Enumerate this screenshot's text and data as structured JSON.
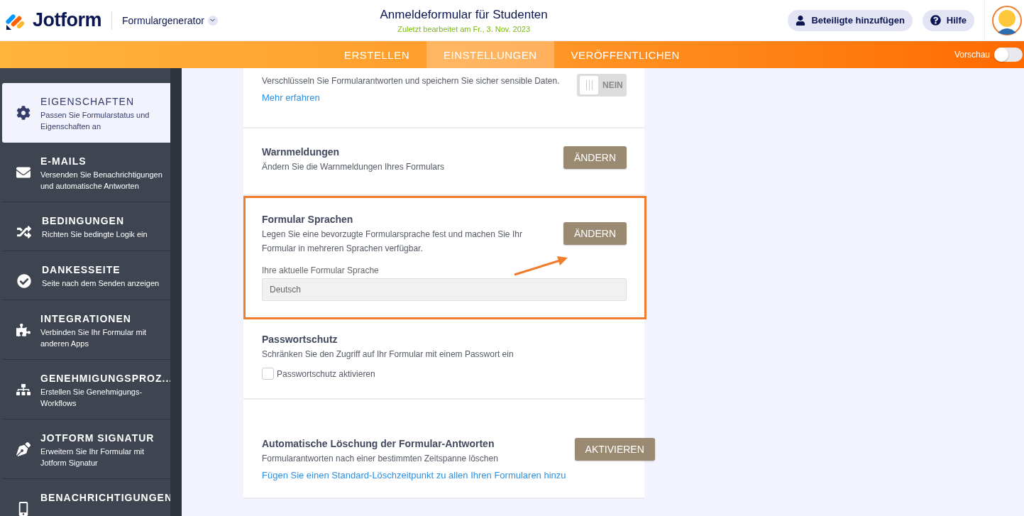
{
  "header": {
    "logo": "Jotform",
    "builder_menu": "Formulargenerator",
    "form_title": "Anmeldeformular für Studenten",
    "last_edited": "Zuletzt bearbeitet am Fr., 3. Nov. 2023",
    "buttons": [
      {
        "kind": "person",
        "label": "Beteiligte hinzufügen"
      },
      {
        "kind": "help",
        "label": "Hilfe"
      }
    ]
  },
  "tabs": [
    {
      "label": "ERSTELLEN",
      "selected": false
    },
    {
      "label": "EINSTELLUNGEN",
      "selected": true
    },
    {
      "label": "VERÖFFENTLICHEN",
      "selected": false
    }
  ],
  "preview": {
    "label": "Vorschau",
    "on": false
  },
  "sidebar": {
    "items": [
      {
        "title": "EIGENSCHAFTEN",
        "subtitle": "Passen Sie Formularstatus und Eigenschaften an",
        "selected": true
      },
      {
        "title": "E-MAILS",
        "subtitle": "Versenden Sie Benachrichtigungen und automatische Antworten",
        "selected": false
      },
      {
        "title": "BEDINGUNGEN",
        "subtitle": "Richten Sie bedingte Logik ein",
        "selected": false
      },
      {
        "title": "DANKESSEITE",
        "subtitle": "Seite nach dem Senden anzeigen",
        "selected": false
      },
      {
        "title": "INTEGRATIONEN",
        "subtitle": "Verbinden Sie Ihr Formular mit anderen Apps",
        "selected": false
      },
      {
        "title": "GENEHMIGUNGSPROZ...",
        "subtitle": "Erstellen Sie Genehmigungs-Workflows",
        "selected": false
      },
      {
        "title": "JOTFORM SIGNATUR",
        "subtitle": "Erweitern Sie Ihr Formular mit Jotform Signatur",
        "selected": false
      },
      {
        "title": "BENACHRICHTIGUNGEN",
        "selected": false
      }
    ]
  },
  "sections": [
    {
      "kind": "toggle",
      "description": "Verschlüsseln Sie Formularantworten und speichern Sie sicher sensible Daten.",
      "link": "Mehr erfahren",
      "toggle_label": "NEIN",
      "on": false
    },
    {
      "kind": "button",
      "title": "Warnmeldungen",
      "description": "Ändern Sie die Warnmeldungen Ihres Formulars",
      "button": "ÄNDERN"
    },
    {
      "kind": "language",
      "title": "Formular Sprachen",
      "description": "Legen Sie eine bevorzugte Formularsprache fest und machen Sie Ihr Formular in mehreren Sprachen verfügbar.",
      "button": "ÄNDERN",
      "field_label": "Ihre aktuelle Formular Sprache",
      "field_value": "Deutsch",
      "highlighted": true
    },
    {
      "kind": "checkbox",
      "title": "Passwortschutz",
      "description": "Schränken Sie den Zugriff auf Ihr Formular mit einem Passwort ein",
      "checkbox_label": "Passwortschutz aktivieren",
      "checked": false
    },
    {
      "kind": "button",
      "title": "Automatische Löschung der Formular-Antworten",
      "description": "Formularantworten nach einer bestimmten Zeitspanne löschen",
      "button": "AKTIVIEREN",
      "link": "Fügen Sie einen Standard-Löschzeitpunkt zu allen Ihren Formularen hinzu"
    }
  ]
}
